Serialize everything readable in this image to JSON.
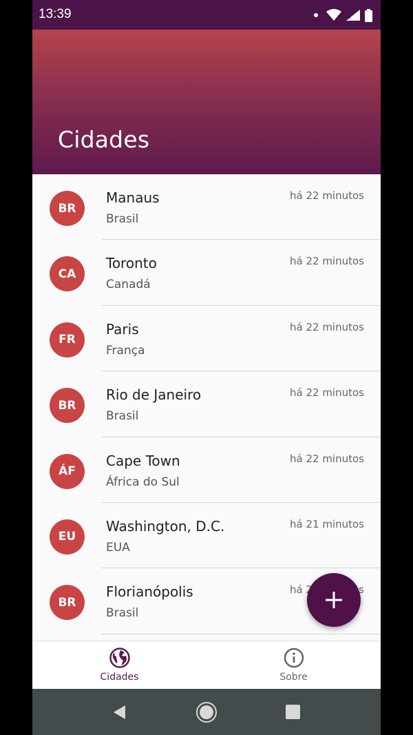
{
  "status_bar": {
    "time": "13:39",
    "network": "4G"
  },
  "header": {
    "title": "Cidades"
  },
  "cities": [
    {
      "initials": "BR",
      "name": "Manaus",
      "country": "Brasil",
      "time": "há 22 minutos"
    },
    {
      "initials": "CA",
      "name": "Toronto",
      "country": "Canadá",
      "time": "há 22 minutos"
    },
    {
      "initials": "FR",
      "name": "Paris",
      "country": "França",
      "time": "há 22 minutos"
    },
    {
      "initials": "BR",
      "name": "Rio de Janeiro",
      "country": "Brasil",
      "time": "há 22 minutos"
    },
    {
      "initials": "ÁF",
      "name": "Cape Town",
      "country": "África do Sul",
      "time": "há 22 minutos"
    },
    {
      "initials": "EU",
      "name": "Washington, D.C.",
      "country": "EUA",
      "time": "há 21 minutos"
    },
    {
      "initials": "BR",
      "name": "Florianópolis",
      "country": "Brasil",
      "time": "há 21 minutos"
    }
  ],
  "fab": {
    "icon": "plus-icon"
  },
  "bottom_nav": {
    "items": [
      {
        "label": "Cidades",
        "icon": "globe-icon",
        "active": true
      },
      {
        "label": "Sobre",
        "icon": "info-icon",
        "active": false
      }
    ]
  },
  "colors": {
    "status_bar": "#4a1448",
    "header_top": "#b5434c",
    "header_bottom": "#5e1a4d",
    "avatar": "#c94444",
    "accent": "#4e1148"
  }
}
